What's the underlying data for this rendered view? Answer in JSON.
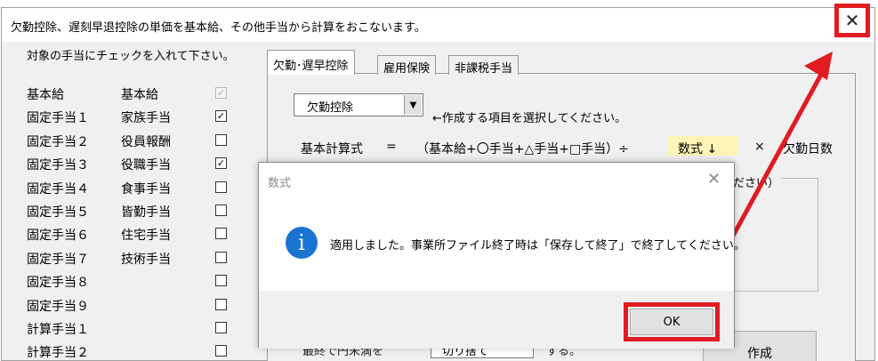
{
  "window": {
    "title": "欠勤控除、遅刻早退控除の単価を基本給、その他手当から計算をおこないます。",
    "close_glyph": "✕"
  },
  "instruction": "対象の手当にチェックを入れて下さい。",
  "allowances": [
    {
      "code": "基本給",
      "name": "基本給",
      "checked": true,
      "disabled": true
    },
    {
      "code": "固定手当１",
      "name": "家族手当",
      "checked": true,
      "disabled": false
    },
    {
      "code": "固定手当２",
      "name": "役員報酬",
      "checked": false,
      "disabled": false
    },
    {
      "code": "固定手当３",
      "name": "役職手当",
      "checked": true,
      "disabled": false
    },
    {
      "code": "固定手当４",
      "name": "食事手当",
      "checked": false,
      "disabled": false
    },
    {
      "code": "固定手当５",
      "name": "皆勤手当",
      "checked": false,
      "disabled": false
    },
    {
      "code": "固定手当６",
      "name": "住宅手当",
      "checked": false,
      "disabled": false
    },
    {
      "code": "固定手当７",
      "name": "技術手当",
      "checked": false,
      "disabled": false
    },
    {
      "code": "固定手当８",
      "name": "",
      "checked": false,
      "disabled": false
    },
    {
      "code": "固定手当９",
      "name": "",
      "checked": false,
      "disabled": false
    },
    {
      "code": "計算手当１",
      "name": "",
      "checked": false,
      "disabled": false
    },
    {
      "code": "計算手当２",
      "name": "",
      "checked": false,
      "disabled": false
    }
  ],
  "tabs": [
    {
      "label": "欠勤･遅早控除",
      "active": true
    },
    {
      "label": "雇用保険",
      "active": false
    },
    {
      "label": "非課税手当",
      "active": false
    }
  ],
  "combo": {
    "value": "欠勤控除",
    "arrow": "▼",
    "hint": "←作成する項目を選択してください。"
  },
  "formula": {
    "label": "基本計算式",
    "equals": "=",
    "expression": "（基本給+〇手当+△手当+□手当）÷",
    "formula_button": "数式 ↓",
    "times": "×",
    "days": "欠勤日数"
  },
  "group_label": "ださい）",
  "create_button": "作成",
  "bottom": {
    "left_text": "最終で円未満を",
    "combo_value": "切り捨て",
    "right_text": "する。"
  },
  "dialog": {
    "title": "数式",
    "close_glyph": "✕",
    "icon_glyph": "i",
    "message": "適用しました。事業所ファイル終了時は「保存して終了」で終了してください。",
    "ok_label": "OK"
  },
  "colors": {
    "highlight": "#e01b22",
    "info_icon": "#1a73d1",
    "formula_bg": "#fdf5b5"
  }
}
